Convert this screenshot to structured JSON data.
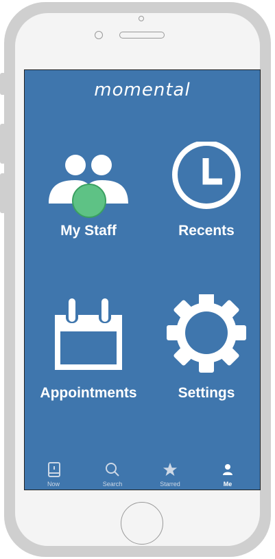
{
  "app": {
    "logo_text": "momental"
  },
  "tiles": [
    {
      "label": "My Staff",
      "icon": "staff-icon"
    },
    {
      "label": "Recents",
      "icon": "clock-icon"
    },
    {
      "label": "Appointments",
      "icon": "calendar-icon"
    },
    {
      "label": "Settings",
      "icon": "gear-icon"
    }
  ],
  "tabbar": {
    "items": [
      {
        "label": "Now",
        "icon": "phone-icon"
      },
      {
        "label": "Search",
        "icon": "search-icon"
      },
      {
        "label": "Starred",
        "icon": "star-icon"
      },
      {
        "label": "Me",
        "icon": "person-icon",
        "active": true
      }
    ]
  },
  "colors": {
    "screen_bg": "#3f76ad",
    "accent_green": "#5ec285",
    "icon_white": "#ffffff"
  }
}
